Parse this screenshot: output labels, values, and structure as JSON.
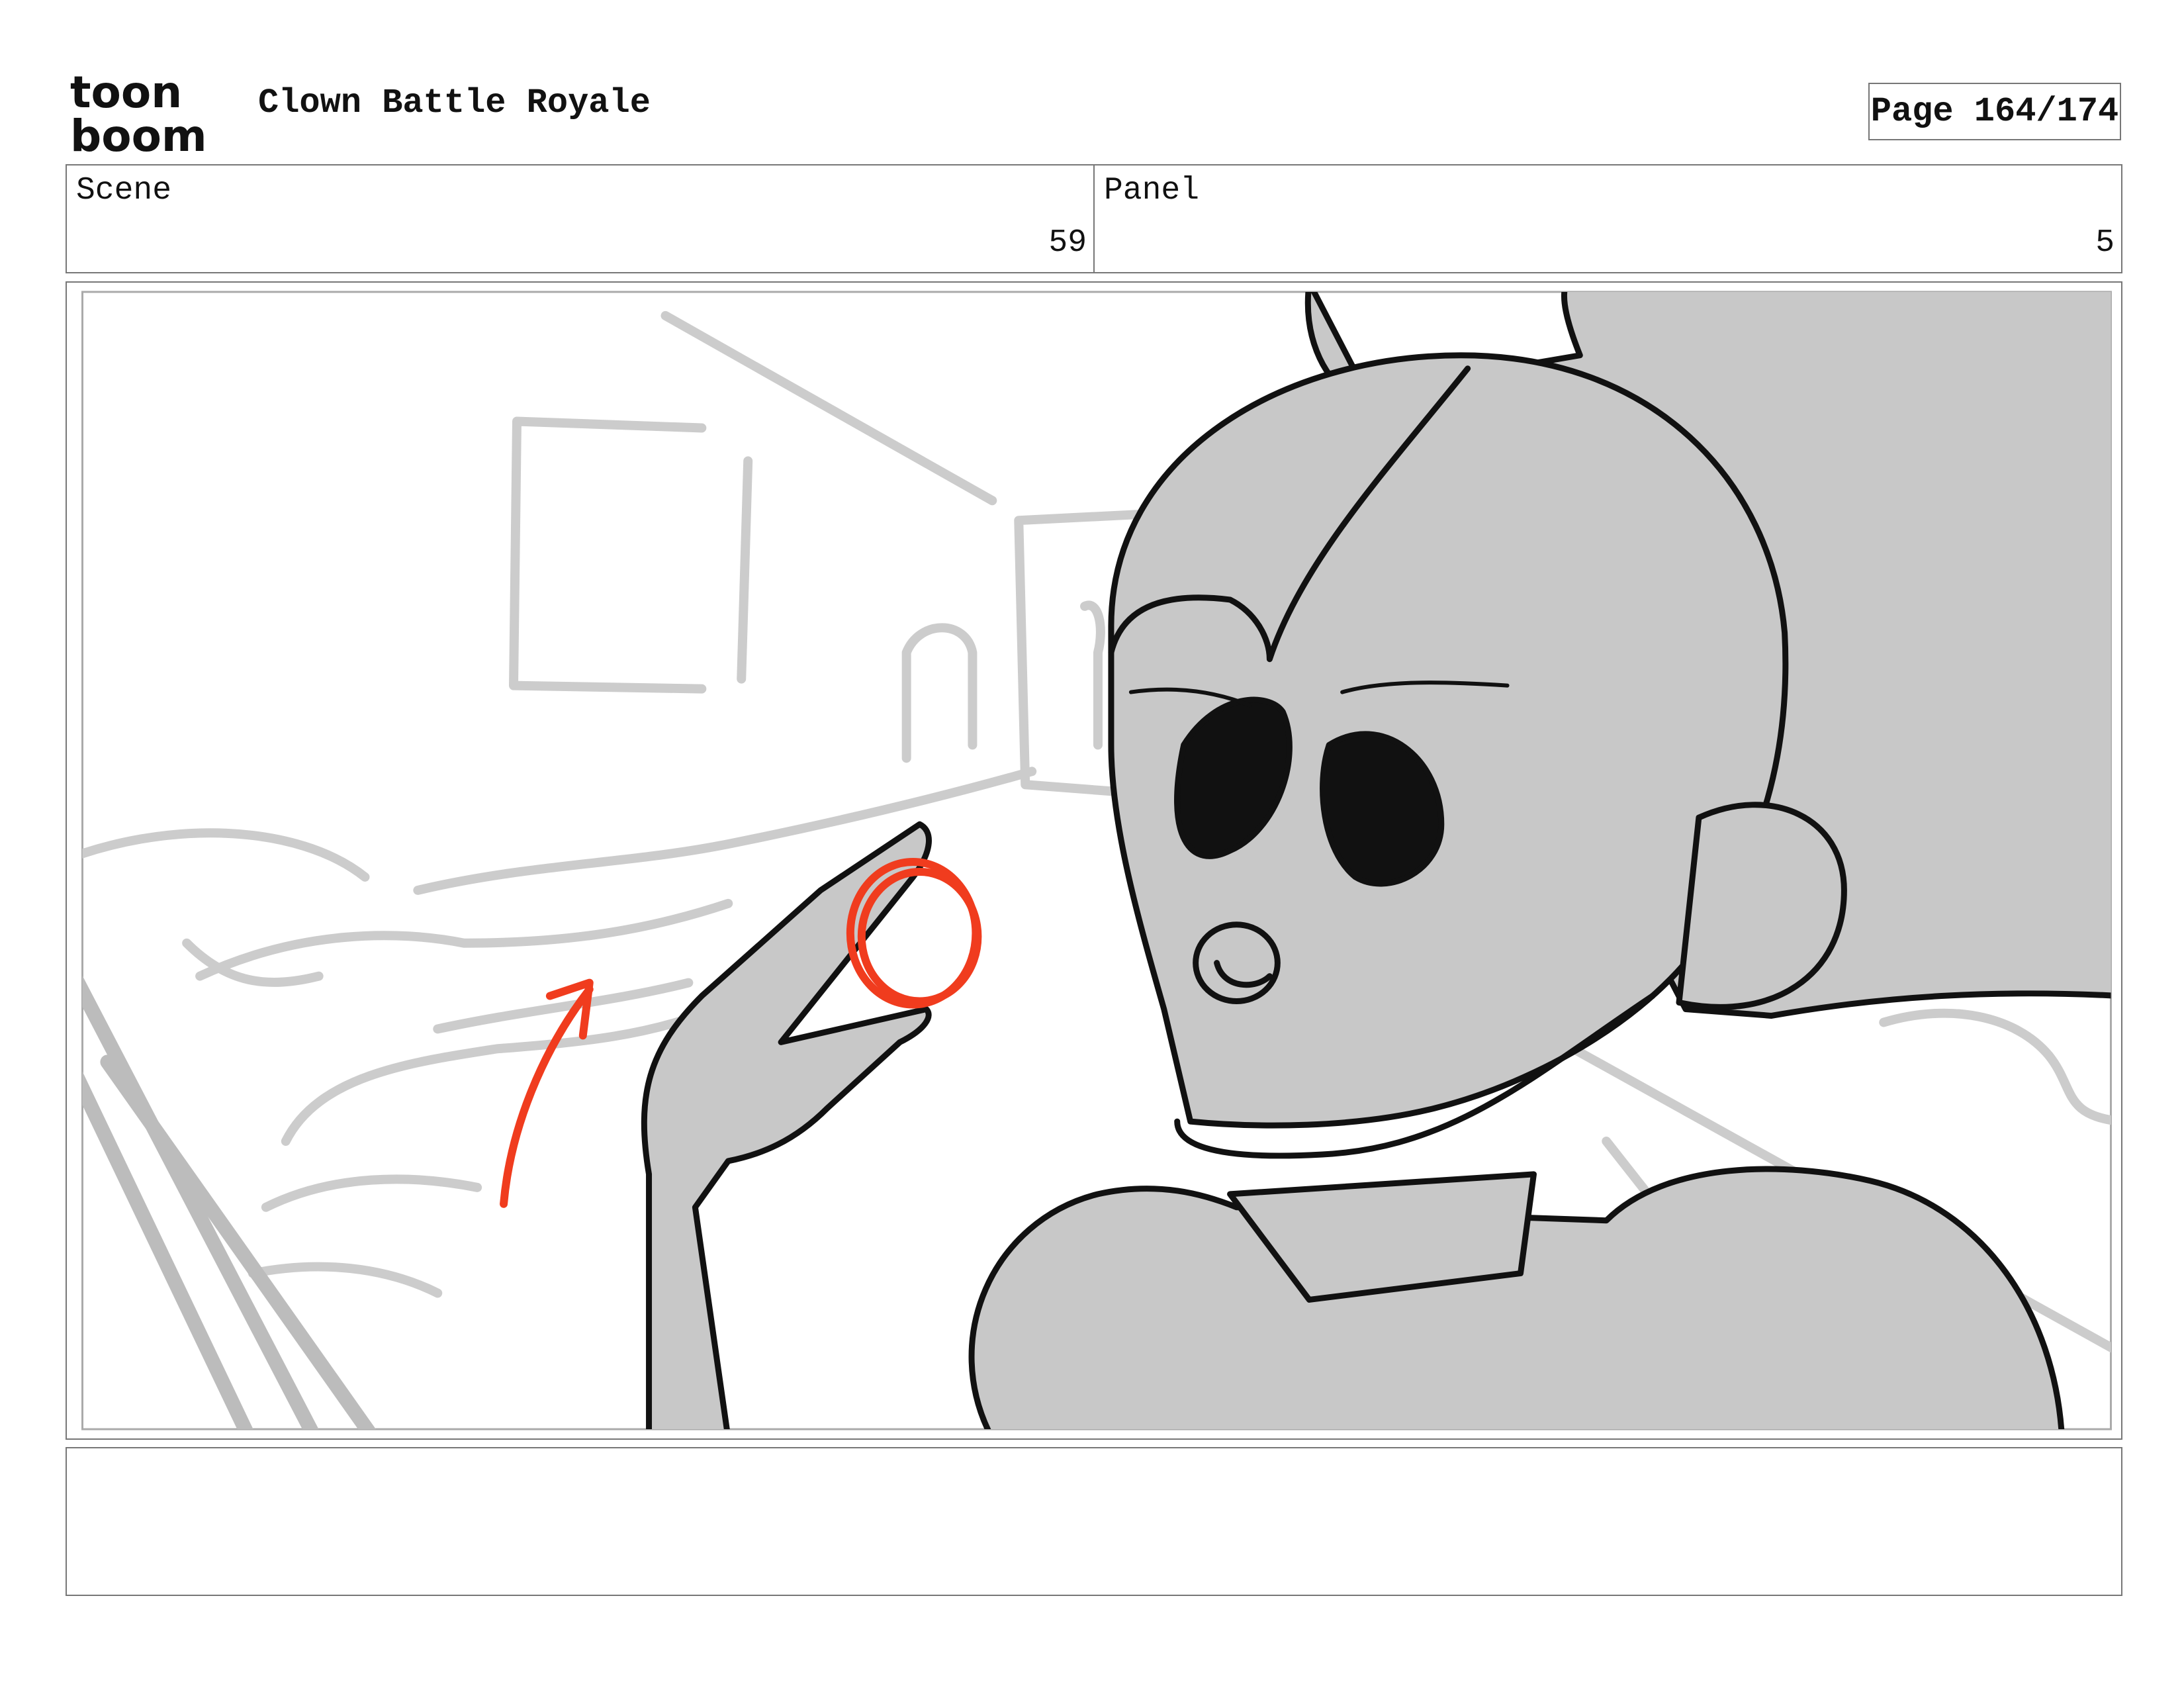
{
  "logo": {
    "line1": "toon",
    "line2": "boom"
  },
  "header": {
    "project_title": "Clown Battle Royale",
    "page_label": "Page 164/174"
  },
  "scene": {
    "label": "Scene",
    "value": "59"
  },
  "panel": {
    "label": "Panel",
    "value": "5"
  },
  "notes": {
    "text": ""
  },
  "colors": {
    "border": "#777777",
    "sketch_gray": "#cccccc",
    "fill_gray": "#c8c8c8",
    "ink": "#111111",
    "annotation_red": "#f03c1e"
  },
  "icons": [
    "toon-boom-logo",
    "motion-arrow-icon"
  ]
}
